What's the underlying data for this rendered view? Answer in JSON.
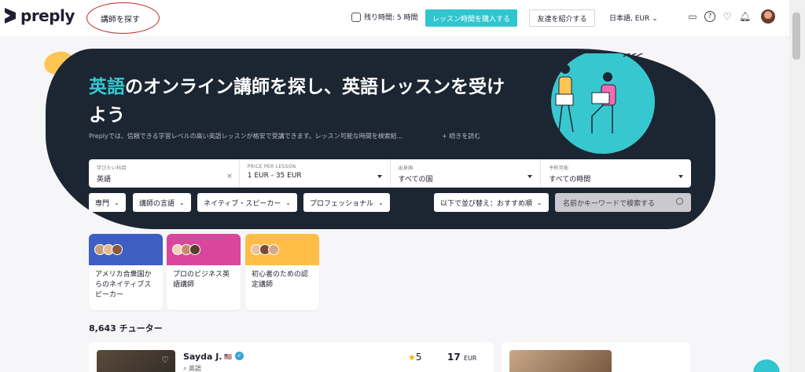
{
  "header": {
    "logo_text": "preply",
    "find_tutor_link": "講師を探す",
    "remaining_hours": "残り時間: 5 時間",
    "buy_button": "レッスン時間を購入する",
    "invite_button": "友達を紹介する",
    "language_currency": "日本語, EUR",
    "icons": [
      "chat-icon",
      "help-icon",
      "favorites-icon",
      "notifications-icon",
      "avatar"
    ]
  },
  "hero": {
    "title_highlight": "英語",
    "title_rest": "のオンライン講師を探し、英語レッスンを受けよう",
    "description": "Preplyでは、信頼できる学習レベルの高い英語レッスンが格安で受講できます。レッスン可能な時間を検索結...",
    "read_more": "+ 続きを読む"
  },
  "filters": {
    "subject": {
      "label": "学びたい科目",
      "value": "英語"
    },
    "price": {
      "label": "PRICE PER LESSON",
      "value": "1 EUR - 35 EUR"
    },
    "country": {
      "label": "出身国",
      "value": "すべての国"
    },
    "availability": {
      "label": "予約可能",
      "value": "すべての時間"
    }
  },
  "chips": {
    "specialty": "専門",
    "tutor_language": "講師の言語",
    "native_speaker": "ネイティブ・スピーカー",
    "professional": "プロフェッショナル",
    "sort": "以下で並び替え：おすすめ順",
    "search_placeholder": "名前かキーワードで検索する"
  },
  "cards": [
    {
      "label": "アメリカ合衆国からのネイティブスピーカー",
      "color": "#3d5fc4"
    },
    {
      "label": "プロのビジネス英語講師",
      "color": "#d9479c"
    },
    {
      "label": "初心者のための認定講師",
      "color": "#ffbd45"
    }
  ],
  "results": {
    "count": "8,643 チューター"
  },
  "tutor": {
    "name": "Sayda J.",
    "flag": "🇺🇸",
    "subject": "英語",
    "rating": "5",
    "price": "17",
    "currency": "EUR"
  },
  "colors": {
    "accent": "#30c5cf",
    "hero_bg": "#1c2633",
    "highlight": "#37c8cf",
    "annotation_circle": "#c8262c"
  }
}
